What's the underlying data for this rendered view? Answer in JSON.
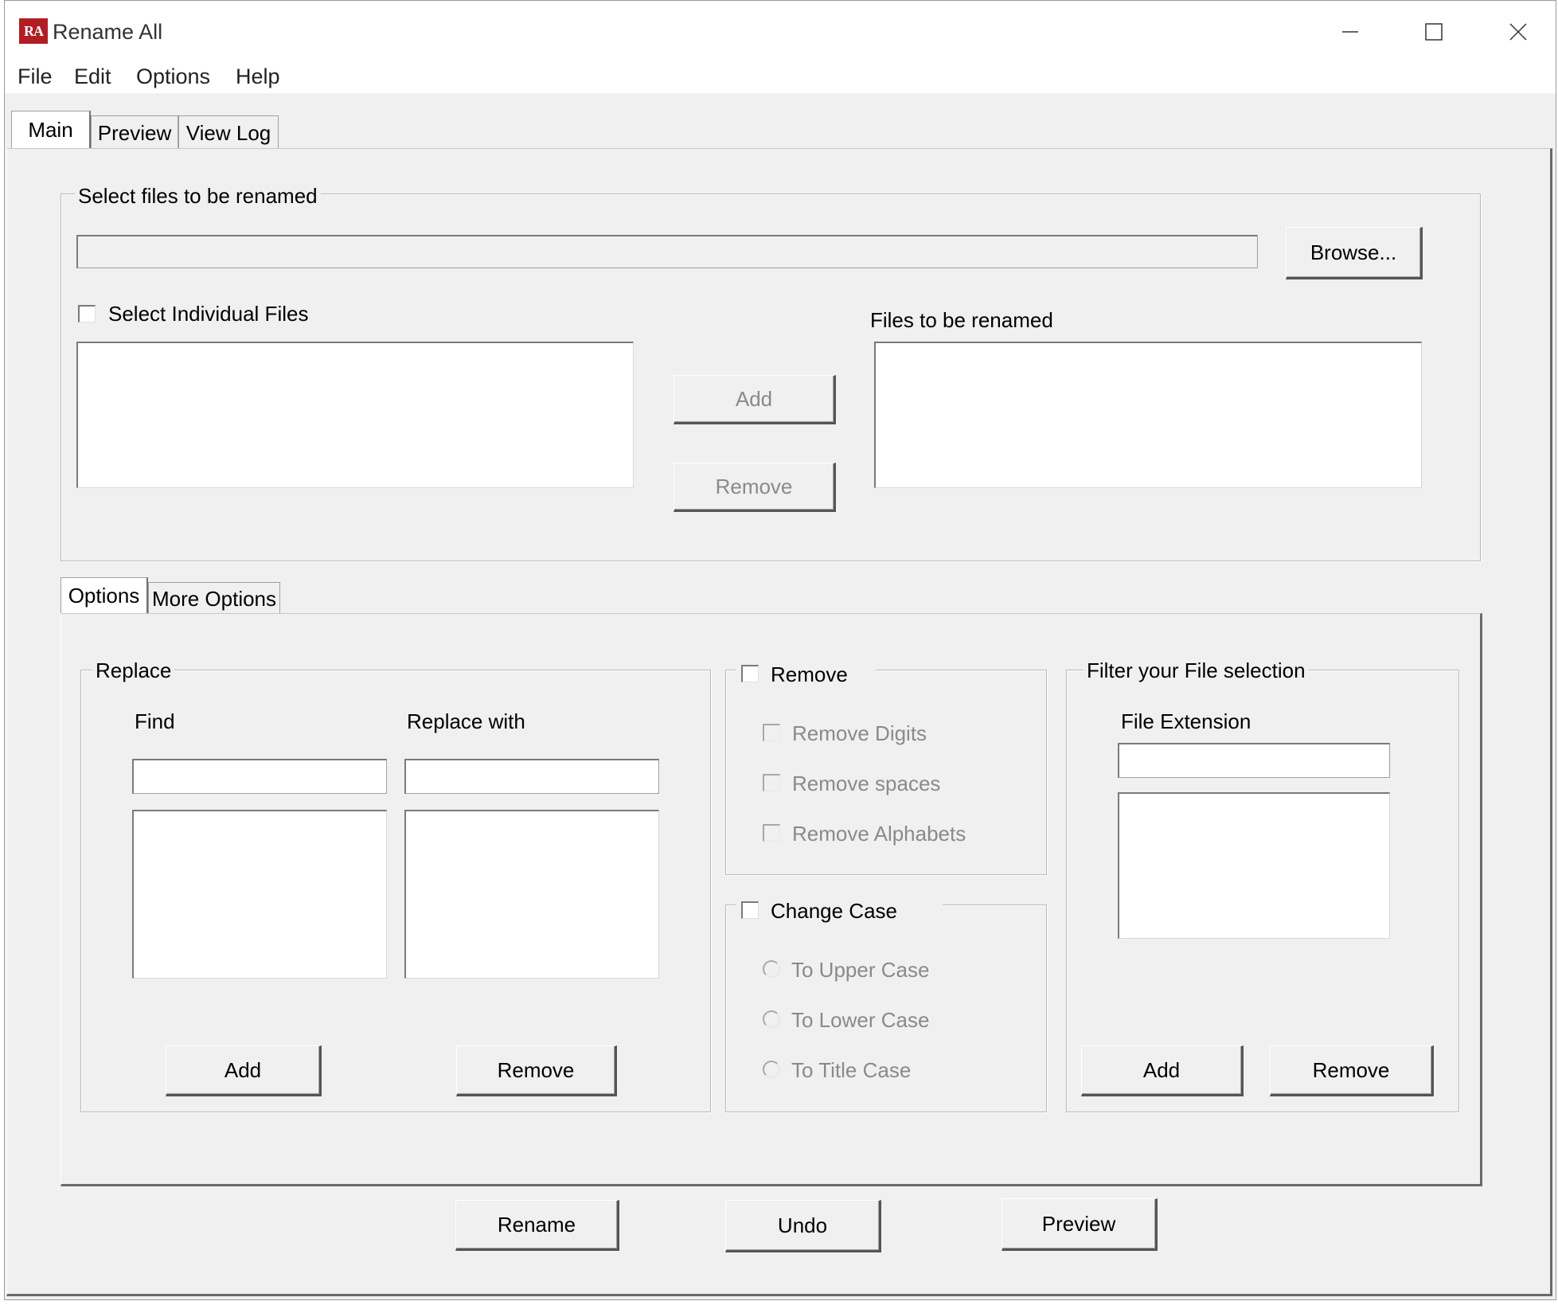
{
  "window": {
    "title": "Rename All",
    "app_icon_text": "RA"
  },
  "menu": [
    "File",
    "Edit",
    "Options",
    "Help"
  ],
  "main_tabs": [
    "Main",
    "Preview",
    "View Log"
  ],
  "select_files": {
    "legend": "Select files to be renamed",
    "path_value": "",
    "browse_label": "Browse...",
    "select_individual_label": "Select Individual Files",
    "select_individual_checked": false,
    "files_to_be_renamed_label": "Files to be renamed",
    "add_label": "Add",
    "remove_label": "Remove"
  },
  "options_tabs": [
    "Options",
    "More Options"
  ],
  "replace": {
    "legend": "Replace",
    "find_label": "Find",
    "replace_with_label": "Replace with",
    "find_value": "",
    "replace_value": "",
    "add_label": "Add",
    "remove_label": "Remove"
  },
  "remove_group": {
    "legend": "Remove",
    "checked": false,
    "options": [
      "Remove Digits",
      "Remove spaces",
      "Remove Alphabets"
    ]
  },
  "change_case": {
    "legend": "Change Case",
    "checked": false,
    "options": [
      "To Upper Case",
      "To Lower Case",
      "To Title Case"
    ]
  },
  "filter": {
    "legend": "Filter your File selection",
    "file_extension_label": "File Extension",
    "extension_value": "",
    "add_label": "Add",
    "remove_label": "Remove"
  },
  "bottom_buttons": {
    "rename": "Rename",
    "undo": "Undo",
    "preview": "Preview"
  },
  "colors": {
    "window_bg": "#f0f0f0",
    "icon_red": "#b01e24",
    "disabled_text": "#8a8a8a"
  }
}
